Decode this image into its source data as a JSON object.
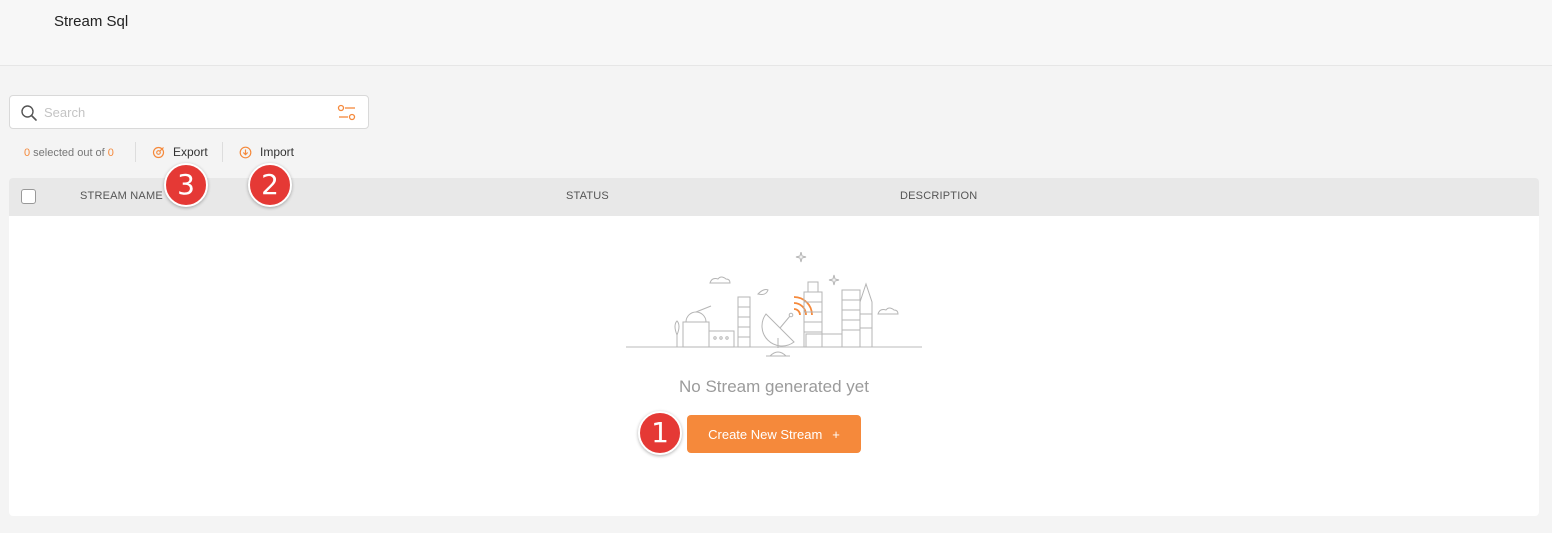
{
  "app": {
    "title": "Stream Sql"
  },
  "search": {
    "placeholder": "Search",
    "value": ""
  },
  "selection": {
    "selected": "0",
    "middle_text": " selected out of ",
    "total": "0"
  },
  "actions": {
    "export_label": "Export",
    "import_label": "Import"
  },
  "table": {
    "columns": [
      "STREAM NAME",
      "STATUS",
      "DESCRIPTION"
    ]
  },
  "empty_state": {
    "message": "No Stream generated yet",
    "create_button_label": "Create New Stream",
    "create_button_plus": "+"
  },
  "annotations": {
    "badge_1": "1",
    "badge_2": "2",
    "badge_3": "3"
  },
  "colors": {
    "accent": "#f5893b",
    "badge": "#e53935"
  }
}
